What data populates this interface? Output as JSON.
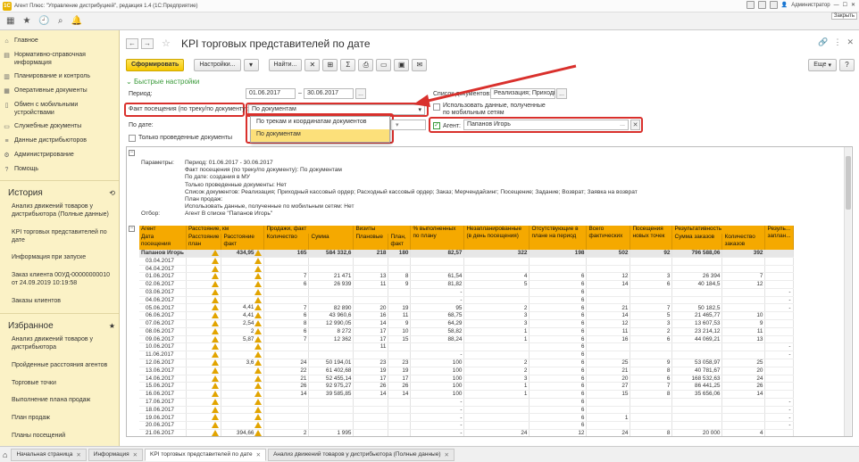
{
  "window": {
    "title": "Агент Плюс: \"Управление дистрибуцией\", редакция 1.4  (1С:Предприятие)",
    "user": "Администратор",
    "close_tooltip": "Закрыть"
  },
  "sidebar": {
    "sections": [
      {
        "icon": "home-icon",
        "label": "Главное"
      },
      {
        "icon": "book-icon",
        "label": "Нормативно-справочная информация"
      },
      {
        "icon": "chart-icon",
        "label": "Планирование и контроль"
      },
      {
        "icon": "doc-icon",
        "label": "Оперативные документы"
      },
      {
        "icon": "mobile-icon",
        "label": "Обмен с мобильными устройствами"
      },
      {
        "icon": "folder-icon",
        "label": "Служебные документы"
      },
      {
        "icon": "database-icon",
        "label": "Данные дистрибьюторов"
      },
      {
        "icon": "gear-icon",
        "label": "Администрирование"
      },
      {
        "icon": "help-icon",
        "label": "Помощь"
      }
    ],
    "history_title": "История",
    "history": [
      "Анализ движений товаров у дистрибьютора (Полные данные)",
      "KPI торговых представителей по дате",
      "Информация при запуске",
      "Заказ клиента 00УД-00000000010 от 24.09.2019 10:19:58",
      "Заказы клиентов"
    ],
    "favorites_title": "Избранное",
    "favorites": [
      "Анализ движений товаров у дистрибьютора",
      "Пройденные расстояния агентов",
      "Торговые точки",
      "Выполнение плана продаж",
      "План продаж",
      "Планы посещений"
    ]
  },
  "form": {
    "title": "KPI торговых представителей по дате",
    "buttons": {
      "generate": "Сформировать",
      "settings": "Настройки...",
      "find": "Найти...",
      "more": "Еще",
      "sigma": "Σ"
    },
    "quick_settings": "Быстрые настройки",
    "period_label": "Период:",
    "period_from": "01.06.2017",
    "period_to": "30.06.2017",
    "period_dash": "–",
    "ellipsis": "...",
    "fact_label": "Факт посещения (по треку/по документу):",
    "fact_value": "По документам",
    "fact_options": [
      "По трекам и координатам документов",
      "По документам"
    ],
    "by_date_label": "По дате:",
    "only_posted_label": "Только проведенные документы",
    "doc_list_label": "Список документов:",
    "doc_list_value": "Реализация; Приходн",
    "use_mobile_label": "Использовать данные, полученные по мобильным сетям",
    "agent_label": "Агент:",
    "agent_value": "Папанов Игорь"
  },
  "report": {
    "params": [
      {
        "k": "Параметры:",
        "v": "Период: 01.06.2017 - 30.06.2017"
      },
      {
        "k": "",
        "v": "Факт посещения (по треку/по документу): По документам"
      },
      {
        "k": "",
        "v": "По дате: создания в МУ"
      },
      {
        "k": "",
        "v": "Только проведенные документы: Нет"
      },
      {
        "k": "",
        "v": "Список документов: Реализация; Приходный кассовый ордер; Расходный кассовый ордер; Заказ; Мерчендайзинг; Посещение; Задание; Возврат; Заявка на возврат"
      },
      {
        "k": "",
        "v": "План продаж:"
      },
      {
        "k": "",
        "v": "Использовать данные, полученные по мобильным сетям: Нет"
      },
      {
        "k": "Отбор:",
        "v": "Агент В списке \"Папанов Игорь\""
      }
    ],
    "headers": {
      "agent": "Агент",
      "date": "Дата посещения",
      "dist": "Расстояние, км",
      "dist_plan": "Расстояние план",
      "dist_fact": "Расстояние факт",
      "sales": "Продажи, факт",
      "qty": "Количество",
      "sum": "Сумма",
      "visits": "Визиты",
      "plan": "Плановые",
      "plan_fact": "План, факт",
      "pct": "% выполненных по плану",
      "unplanned": "Незапланированные (в день посещения)",
      "absent": "Отсутствующие в плане на период",
      "total": "Всего фактических",
      "newpts": "Посещения новых точек",
      "res": "Результативность",
      "orders_sum": "Сумма заказов",
      "orders_qty": "Количество заказов",
      "res_more": "Резуль... заплан..."
    },
    "total_row": [
      "Папанов Игорь",
      "",
      "",
      "434,95",
      "165",
      "584 332,6",
      "218",
      "180",
      "82,57",
      "322",
      "198",
      "502",
      "92",
      "796 588,06",
      "392",
      ""
    ],
    "rows": [
      [
        "03.04.2017",
        "",
        "",
        "",
        "",
        "",
        "",
        "",
        "",
        "",
        "",
        "",
        "",
        "",
        "",
        ""
      ],
      [
        "04.04.2017",
        "",
        "",
        "",
        "",
        "",
        "",
        "",
        "",
        "",
        "",
        "",
        "",
        "",
        "",
        ""
      ],
      [
        "01.06.2017",
        "",
        "",
        "7",
        "21 471",
        "13",
        "8",
        "61,54",
        "4",
        "6",
        "12",
        "3",
        "26 394",
        "7",
        ""
      ],
      [
        "02.06.2017",
        "",
        "",
        "6",
        "26 939",
        "11",
        "9",
        "81,82",
        "5",
        "6",
        "14",
        "6",
        "40 184,5",
        "12",
        ""
      ],
      [
        "03.06.2017",
        "",
        "",
        "",
        "",
        "",
        "",
        "-",
        "",
        "6",
        "",
        "",
        "",
        "",
        "-"
      ],
      [
        "04.06.2017",
        "",
        "",
        "",
        "",
        "",
        "",
        "-",
        "",
        "6",
        "",
        "",
        "",
        "",
        "-"
      ],
      [
        "05.06.2017",
        "",
        "4,41",
        "7",
        "82 890",
        "20",
        "19",
        "95",
        "2",
        "6",
        "21",
        "7",
        "50 182,5",
        "",
        "-"
      ],
      [
        "06.06.2017",
        "",
        "4,41",
        "6",
        "43 960,6",
        "16",
        "11",
        "68,75",
        "3",
        "6",
        "14",
        "5",
        "21 465,77",
        "10",
        ""
      ],
      [
        "07.06.2017",
        "",
        "2,54",
        "8",
        "12 990,05",
        "14",
        "9",
        "64,29",
        "3",
        "6",
        "12",
        "3",
        "13 607,53",
        "9",
        ""
      ],
      [
        "08.06.2017",
        "",
        "2",
        "6",
        "8 272",
        "17",
        "10",
        "58,82",
        "1",
        "6",
        "11",
        "2",
        "23 214,12",
        "11",
        ""
      ],
      [
        "09.06.2017",
        "",
        "5,87",
        "7",
        "12 362",
        "17",
        "15",
        "88,24",
        "1",
        "6",
        "16",
        "6",
        "44 069,21",
        "13",
        ""
      ],
      [
        "10.06.2017",
        "",
        "",
        "",
        "",
        "11",
        "",
        "",
        "",
        "6",
        "",
        "",
        "",
        "",
        "-"
      ],
      [
        "11.06.2017",
        "",
        "",
        "",
        "",
        "",
        "",
        "-",
        "",
        "6",
        "",
        "",
        "",
        "",
        "-"
      ],
      [
        "12.06.2017",
        "",
        "3,6",
        "24",
        "50 194,01",
        "23",
        "23",
        "100",
        "2",
        "6",
        "25",
        "9",
        "53 058,97",
        "25",
        ""
      ],
      [
        "13.06.2017",
        "",
        "",
        "22",
        "61 402,68",
        "19",
        "19",
        "100",
        "2",
        "6",
        "21",
        "8",
        "40 781,67",
        "20",
        ""
      ],
      [
        "14.06.2017",
        "",
        "",
        "21",
        "52 455,14",
        "17",
        "17",
        "100",
        "3",
        "6",
        "20",
        "6",
        "168 532,63",
        "24",
        ""
      ],
      [
        "15.06.2017",
        "",
        "",
        "26",
        "92 975,27",
        "26",
        "26",
        "100",
        "1",
        "6",
        "27",
        "7",
        "86 441,25",
        "26",
        ""
      ],
      [
        "16.06.2017",
        "",
        "",
        "14",
        "39 585,85",
        "14",
        "14",
        "100",
        "1",
        "6",
        "15",
        "8",
        "35 656,06",
        "14",
        ""
      ],
      [
        "17.06.2017",
        "",
        "",
        "",
        "",
        "",
        "",
        "-",
        "",
        "6",
        "",
        "",
        "",
        "",
        "-"
      ],
      [
        "18.06.2017",
        "",
        "",
        "",
        "",
        "",
        "",
        "-",
        "",
        "6",
        "",
        "",
        "",
        "",
        "-"
      ],
      [
        "19.06.2017",
        "",
        "",
        "",
        "",
        "",
        "",
        "-",
        "",
        "6",
        "1",
        "",
        "",
        "",
        "-"
      ],
      [
        "20.06.2017",
        "",
        "",
        "",
        "",
        "",
        "",
        "-",
        "",
        "6",
        "",
        "",
        "",
        "",
        "-"
      ],
      [
        "21.06.2017",
        "",
        "394,66",
        "2",
        "1 995",
        "",
        "",
        "-",
        "24",
        "12",
        "24",
        "8",
        "20 000",
        "4",
        ""
      ]
    ]
  },
  "tabs": [
    {
      "label": "Начальная страница",
      "active": false
    },
    {
      "label": "Информация",
      "active": false
    },
    {
      "label": "KPI торговых представителей по дате",
      "active": true
    },
    {
      "label": "Анализ движений товаров у дистрибьютора (Полные данные)",
      "active": false
    }
  ],
  "colors": {
    "accent": "#f5c800",
    "header": "#f5a900",
    "highlight": "#d9302c",
    "sidebar": "#fbf2c6"
  }
}
